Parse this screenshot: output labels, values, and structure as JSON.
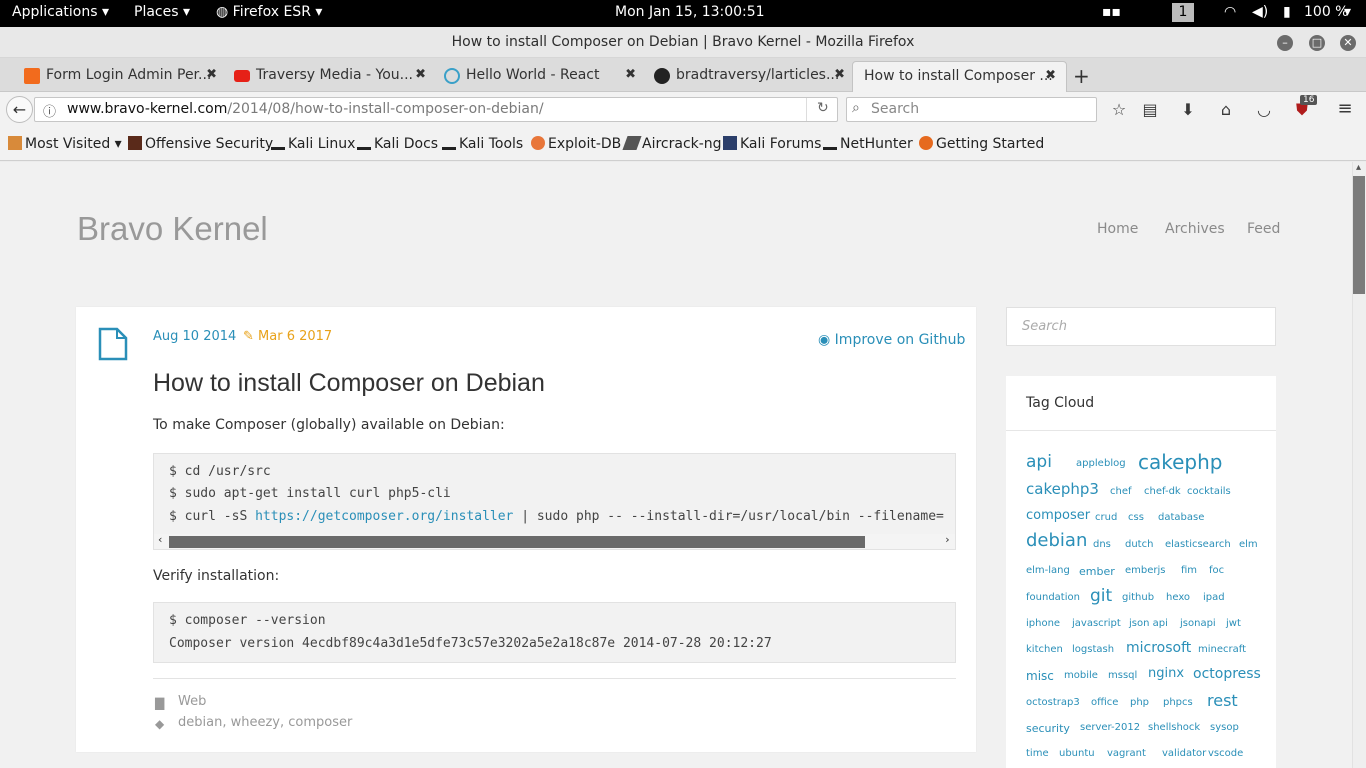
{
  "topbar": {
    "applications": "Applications",
    "places": "Places",
    "browser": "Firefox ESR",
    "clock": "Mon Jan 15, 13:00:51",
    "workspace": "1",
    "battery": "100 %"
  },
  "window": {
    "title": "How to install Composer on Debian | Bravo Kernel - Mozilla Firefox"
  },
  "tabs": [
    {
      "label": "Form Login Admin Per..."
    },
    {
      "label": "Traversy Media - You..."
    },
    {
      "label": "Hello World - React"
    },
    {
      "label": "bradtraversy/larticles..."
    },
    {
      "label": "How to install Composer ..."
    }
  ],
  "nav": {
    "url_domain": "www.bravo-kernel.com",
    "url_path": "/2014/08/how-to-install-composer-on-debian/",
    "search_placeholder": "Search",
    "ublock_badge": "16"
  },
  "bookmarks": [
    "Most Visited",
    "Offensive Security",
    "Kali Linux",
    "Kali Docs",
    "Kali Tools",
    "Exploit-DB",
    "Aircrack-ng",
    "Kali Forums",
    "NetHunter",
    "Getting Started"
  ],
  "site": {
    "name": "Bravo Kernel",
    "nav": [
      "Home",
      "Archives",
      "Feed"
    ]
  },
  "post": {
    "date": "Aug 10 2014",
    "updated": "Mar 6 2017",
    "improve": "Improve on Github",
    "title": "How to install Composer on Debian",
    "intro": "To make Composer (globally) available on Debian:",
    "code1": {
      "l1": "$ cd /usr/src",
      "l2": "$ sudo apt-get install curl php5-cli",
      "l3_pre": "$ curl -sS ",
      "l3_link": "https://getcomposer.org/installer",
      "l3_post": " | sudo php -- --install-dir=/usr/local/bin --filename="
    },
    "verify": "Verify installation:",
    "code2": {
      "l1": "$ composer --version",
      "l2": "Composer version 4ecdbf89c4a3d1e5dfe73c57e3202a5e2a18c87e 2014-07-28 20:12:27"
    },
    "category": "Web",
    "tags": "debian, wheezy, composer"
  },
  "sidebar": {
    "search_placeholder": "Search",
    "tagcloud_title": "Tag Cloud"
  },
  "tags": [
    "api",
    "apple",
    "blog",
    "cakephp",
    "cakephp3",
    "chef",
    "chef-dk",
    "cocktails",
    "composer",
    "crud",
    "css",
    "database",
    "debian",
    "dns",
    "dutch",
    "elasticsearch",
    "elm",
    "elm-lang",
    "ember",
    "emberjs",
    "fim",
    "foc",
    "foundation",
    "git",
    "github",
    "hexo",
    "ipad",
    "iphone",
    "javascript",
    "json api",
    "jsonapi",
    "jwt",
    "kitchen",
    "logstash",
    "microsoft",
    "minecraft",
    "misc",
    "mobile",
    "mssql",
    "nginx",
    "octopress",
    "octostrap3",
    "office",
    "php",
    "phpcs",
    "rest",
    "security",
    "server-2012",
    "shellshock",
    "sysop",
    "time",
    "ubuntu",
    "vagrant",
    "validator",
    "vscode"
  ],
  "colors": {
    "link": "#2a8fb8",
    "updated": "#e8a21a",
    "heading": "#333333"
  }
}
